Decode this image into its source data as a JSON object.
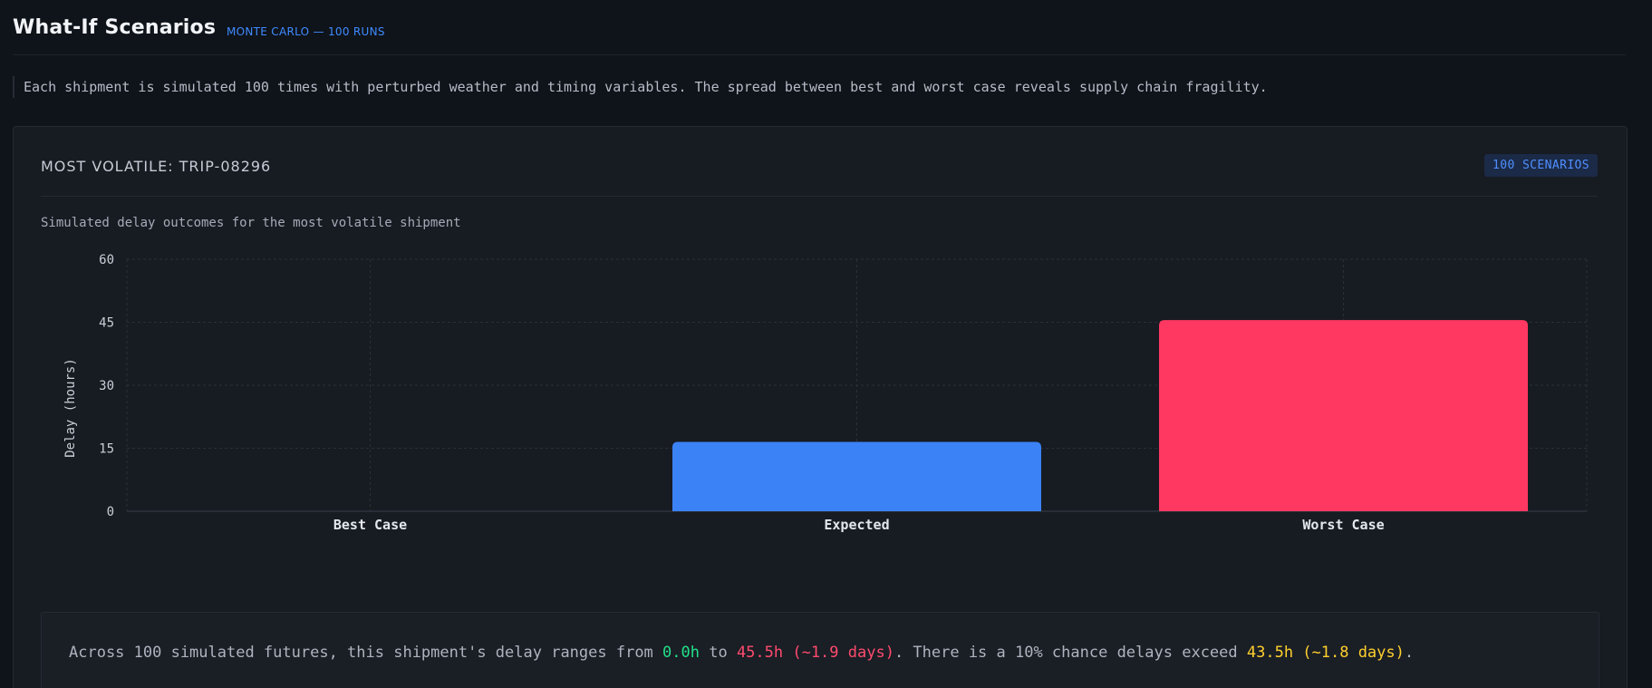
{
  "header": {
    "title": "What-If Scenarios",
    "badge": "MONTE CARLO — 100 RUNS"
  },
  "description": "Each shipment is simulated 100 times with perturbed weather and timing variables. The spread between best and worst case reveals supply chain fragility.",
  "card": {
    "title": "MOST VOLATILE: TRIP-08296",
    "badge": "100 SCENARIOS",
    "caption": "Simulated delay outcomes for the most volatile shipment"
  },
  "insight": {
    "prefix": "Across 100 simulated futures, this shipment's delay ranges from ",
    "best": "0.0h",
    "to": " to ",
    "worst": "45.5h (~1.9 days)",
    "middle": ". There is a 10% chance delays exceed ",
    "p90": "43.5h (~1.8 days)",
    "suffix": "."
  },
  "colors": {
    "expected": "#3b82f6",
    "worst": "#ff3862",
    "best": "#22e08a",
    "grid": "#2a303a",
    "axis_text": "#c9ced8"
  },
  "chart_data": {
    "type": "bar",
    "categories": [
      "Best Case",
      "Expected",
      "Worst Case"
    ],
    "values": [
      0.0,
      16.5,
      45.5
    ],
    "title": "",
    "xlabel": "",
    "ylabel": "Delay (hours)",
    "ylim": [
      0,
      60
    ],
    "yticks": [
      0,
      15,
      30,
      45,
      60
    ],
    "grid": true,
    "legend": "none"
  }
}
